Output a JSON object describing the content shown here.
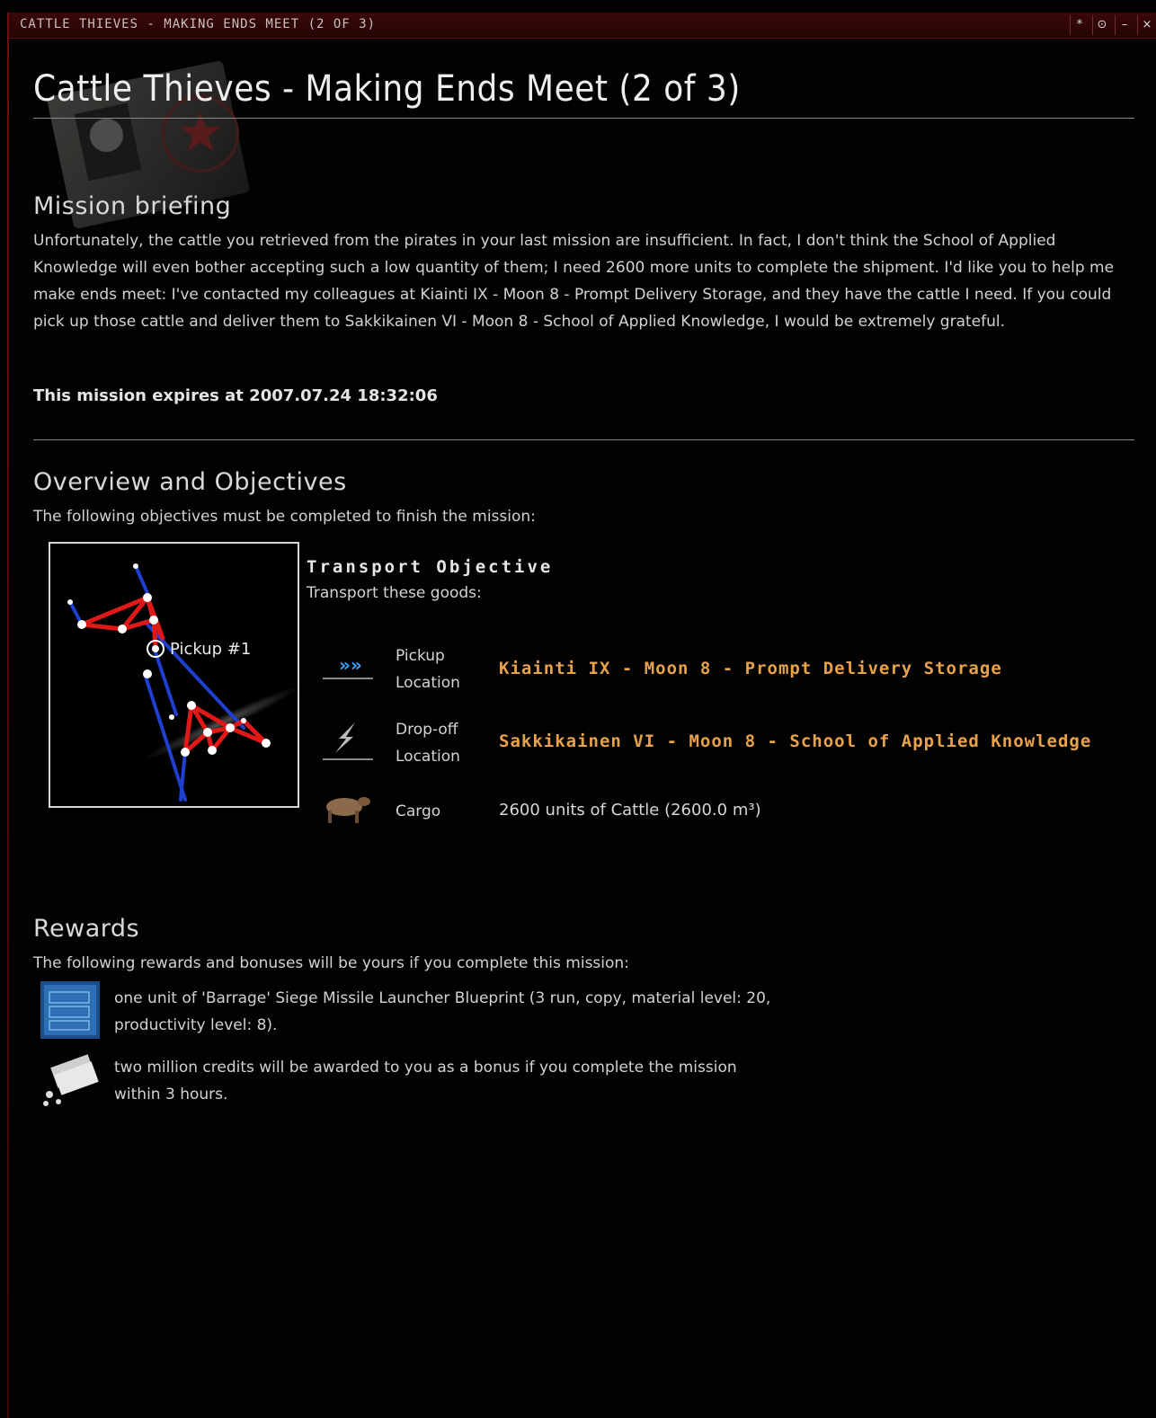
{
  "window": {
    "title": "CATTLE THIEVES - MAKING ENDS MEET (2 OF 3)",
    "buttons": [
      "*",
      "⊙",
      "–",
      "×"
    ]
  },
  "mission": {
    "title": "Cattle Thieves - Making Ends Meet (2 of 3)"
  },
  "briefing": {
    "heading": "Mission briefing",
    "text": "Unfortunately, the cattle you retrieved from the pirates in your last mission are insufficient. In fact, I don't think the School of Applied Knowledge will even bother accepting such a low quantity of them; I need 2600 more units to complete the shipment. I'd like you to help me make ends meet: I've contacted my colleagues at Kiainti IX - Moon 8 - Prompt Delivery Storage, and they have the cattle I need. If you could pick up those cattle and deliver them to Sakkikainen VI - Moon 8 - School of Applied Knowledge, I would be extremely grateful.",
    "expires": "This mission expires at 2007.07.24 18:32:06"
  },
  "overview": {
    "heading": "Overview and Objectives",
    "intro": "The following objectives must be completed to finish the mission:",
    "map_label": "Pickup #1",
    "objective_title": "Transport Objective",
    "objective_subtitle": "Transport these goods:",
    "rows": [
      {
        "label": "Pickup Location",
        "value": "Kiainti IX - Moon 8 - Prompt Delivery Storage",
        "icon": "corporation-logo-icon"
      },
      {
        "label": "Drop-off Location",
        "value": "Sakkikainen VI - Moon 8 - School of Applied Knowledge",
        "icon": "school-logo-icon"
      },
      {
        "label": "Cargo",
        "value": "2600 units of Cattle (2600.0 m³)",
        "icon": "cattle-icon"
      }
    ]
  },
  "rewards": {
    "heading": "Rewards",
    "intro": "The following rewards and bonuses will be yours if you complete this mission:",
    "items": [
      {
        "text": "one unit of 'Barrage' Siege Missile Launcher Blueprint (3 run, copy, material level: 20, productivity level: 8).",
        "icon": "blueprint-icon"
      },
      {
        "text": "two million credits will be awarded to you as a bonus if you complete the mission within 3 hours.",
        "icon": "isk-credits-icon"
      }
    ]
  },
  "colors": {
    "background": "#000000",
    "titlebar": "#2e0505",
    "link": "#e8a24a",
    "route_red": "#e01818",
    "route_blue": "#1f3fd0"
  }
}
